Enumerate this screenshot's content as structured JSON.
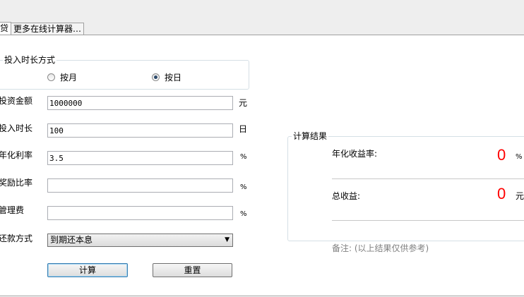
{
  "tabs": [
    {
      "label": "贷",
      "active": true
    },
    {
      "label": "更多在线计算器…",
      "active": false
    }
  ],
  "duration_mode": {
    "legend": "投入时长方式",
    "options": [
      {
        "label": "按月",
        "checked": false
      },
      {
        "label": "按日",
        "checked": true
      }
    ]
  },
  "fields": [
    {
      "label": "投资金额",
      "value": "1000000",
      "unit": "元"
    },
    {
      "label": "投入时长",
      "value": "100",
      "unit": "日"
    },
    {
      "label": "年化利率",
      "value": "3.5",
      "unit": "%"
    },
    {
      "label": "奖励比率",
      "value": "",
      "unit": "%"
    },
    {
      "label": "管理费",
      "value": "",
      "unit": "%"
    }
  ],
  "repayment": {
    "label": "还款方式",
    "selected": "到期还本息"
  },
  "buttons": {
    "calculate": "计算",
    "reset": "重置"
  },
  "result": {
    "legend": "计算结果",
    "annual_yield_label": "年化收益率:",
    "annual_yield_value": "0",
    "annual_yield_unit": "%",
    "total_income_label": "总收益:",
    "total_income_value": "0",
    "total_income_unit": "元"
  },
  "note": "备注: (以上结果仅供参考)",
  "colors": {
    "result_value": "#ff0000",
    "note_text": "#808080"
  }
}
